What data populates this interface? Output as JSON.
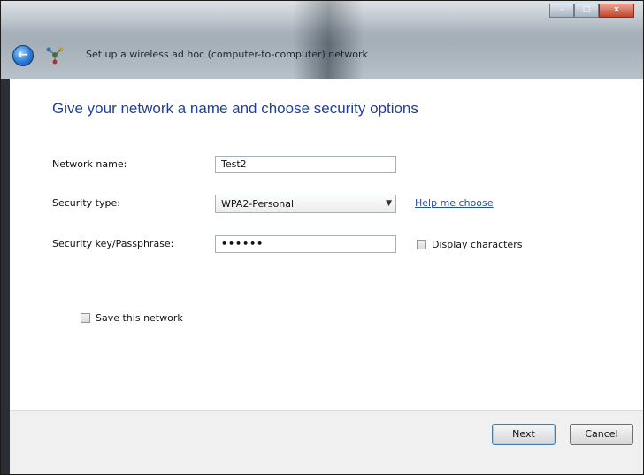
{
  "window": {
    "title": "Set up a wireless ad hoc (computer-to-computer) network",
    "caption_buttons": {
      "minimize": "–",
      "maximize": "□",
      "close": "x"
    }
  },
  "main": {
    "heading": "Give your network a name and choose security options",
    "network_name": {
      "label": "Network name:",
      "value": "Test2"
    },
    "security_type": {
      "label": "Security type:",
      "value": "WPA2-Personal",
      "help_link": "Help me choose"
    },
    "security_key": {
      "label": "Security key/Passphrase:",
      "value": "••••••",
      "display_characters_label": "Display characters"
    },
    "save_network_label": "Save this network"
  },
  "footer": {
    "next_label": "Next",
    "cancel_label": "Cancel"
  },
  "icons": {
    "back": "back-arrow-icon",
    "network": "network-icon",
    "dropdown": "chevron-down-icon"
  }
}
